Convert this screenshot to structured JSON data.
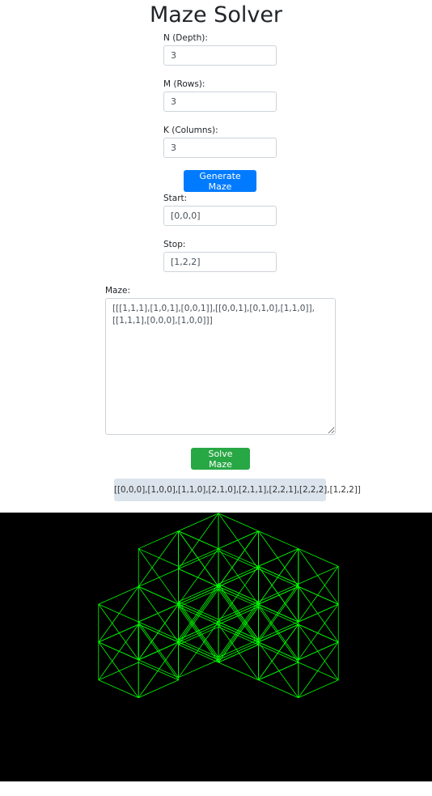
{
  "page": {
    "title": "Maze Solver"
  },
  "form": {
    "depth": {
      "label": "N (Depth):",
      "value": "3"
    },
    "rows": {
      "label": "M (Rows):",
      "value": "3"
    },
    "columns": {
      "label": "K (Columns):",
      "value": "3"
    },
    "generate_label": "Generate Maze",
    "start": {
      "label": "Start:",
      "value": "[0,0,0]"
    },
    "stop": {
      "label": "Stop:",
      "value": "[1,2,2]"
    },
    "maze": {
      "label": "Maze:",
      "value": "[[[1,1,1],[1,0,1],[0,0,1]],[[0,0,1],[0,1,0],[1,1,0]],[[1,1,1],[0,0,0],[1,0,0]]]"
    },
    "solve_label": "Solve Maze"
  },
  "result": {
    "path": "[[0,0,0],[1,0,0],[1,1,0],[2,1,0],[2,1,1],[2,2,1],[2,2,2],[1,2,2]]"
  },
  "viewer": {
    "background": "#000000",
    "wire_color": "#00ff00"
  }
}
